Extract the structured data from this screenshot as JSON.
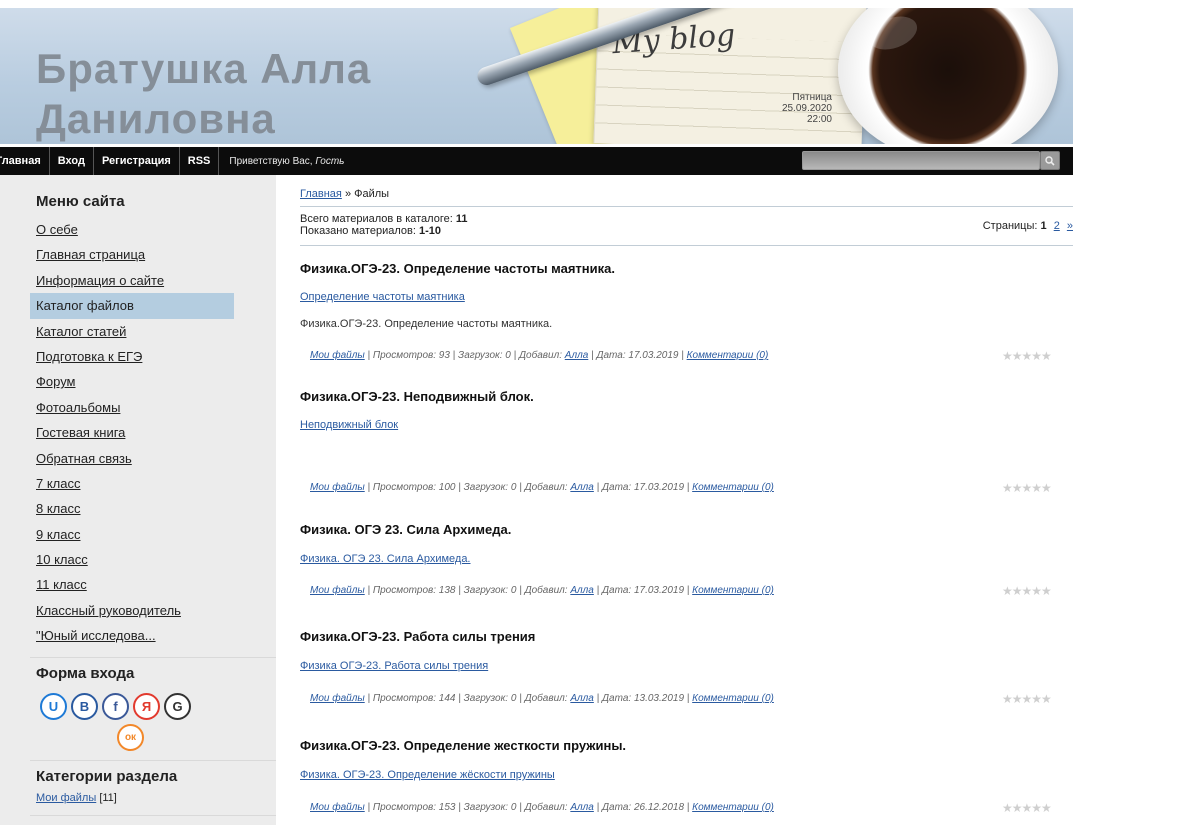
{
  "header": {
    "title_line1": "Братушка Алла",
    "title_line2": "Даниловна",
    "blog_script": "My blog",
    "day": "Пятница",
    "date": "25.09.2020",
    "time": "22:00"
  },
  "nav": {
    "items": [
      "Главная",
      "Вход",
      "Регистрация",
      "RSS"
    ],
    "greeting_prefix": "Приветствую Вас,",
    "greeting_name": "Гость",
    "search_value": ""
  },
  "sidebar": {
    "menu_title": "Меню сайта",
    "menu": [
      "О себе",
      "Главная страница",
      "Информация о сайте",
      "Каталог файлов",
      "Каталог статей",
      "Подготовка к ЕГЭ",
      "Форум",
      "Фотоальбомы",
      "Гостевая книга",
      "Обратная связь",
      "7 класс",
      "8 класс",
      "9 класс",
      "10 класс",
      "11 класс",
      "Классный руководитель",
      "\"Юный исследова..."
    ],
    "active_item": "Каталог файлов",
    "login_title": "Форма входа",
    "social": [
      "U",
      "В",
      "f",
      "Я",
      "G",
      "ок"
    ],
    "categories_title": "Категории раздела",
    "category_link": "Мои файлы",
    "category_count": "[11]"
  },
  "main": {
    "breadcrumb_home": "Главная",
    "breadcrumb_sep": "»",
    "breadcrumb_current": "Файлы",
    "total_label": "Всего материалов в каталоге:",
    "total_value": "11",
    "shown_label": "Показано материалов:",
    "shown_value": "1-10",
    "pages_label": "Страницы:",
    "page_current": "1",
    "page_next": "2",
    "page_arrow": "»",
    "entries": [
      {
        "title": "Физика.ОГЭ-23. Определение частоты маятника.",
        "link": "Определение частоты маятника",
        "desc": "Физика.ОГЭ-23. Определение частоты маятника.",
        "category": "Мои файлы",
        "views": "| Просмотров: 93 | Загрузок: 0 | Добавил:",
        "author": "Алла",
        "date": "| Дата: 17.03.2019 |",
        "comments": "Комментарии (0)"
      },
      {
        "title": "Физика.ОГЭ-23. Неподвижный блок.",
        "link": "Неподвижный блок",
        "desc": "",
        "category": "Мои файлы",
        "views": "| Просмотров: 100 | Загрузок: 0 | Добавил:",
        "author": "Алла",
        "date": "| Дата: 17.03.2019 |",
        "comments": "Комментарии (0)"
      },
      {
        "title": "Физика. ОГЭ 23. Сила Архимеда.",
        "link": "Физика. ОГЭ 23. Сила Архимеда.",
        "desc": "",
        "category": "Мои файлы",
        "views": "| Просмотров: 138 | Загрузок: 0 | Добавил:",
        "author": "Алла",
        "date": "| Дата: 17.03.2019 |",
        "comments": "Комментарии (0)"
      },
      {
        "title": "Физика.ОГЭ-23. Работа силы трения",
        "link": "Физика ОГЭ-23. Работа силы трения",
        "desc": "",
        "category": "Мои файлы",
        "views": "| Просмотров: 144 | Загрузок: 0 | Добавил:",
        "author": "Алла",
        "date": "| Дата: 13.03.2019 |",
        "comments": "Комментарии (0)"
      },
      {
        "title": "Физика.ОГЭ-23. Определение жесткости пружины.",
        "link": "Физика. ОГЭ-23. Определение жёскости пружины",
        "desc": "",
        "category": "Мои файлы",
        "views": "| Просмотров: 153 | Загрузок: 0 | Добавил:",
        "author": "Алла",
        "date": "| Дата: 26.12.2018 |",
        "comments": "Комментарии (0)"
      }
    ],
    "rating_stars": "★★★★★"
  },
  "colors": {
    "social_u": "#1e7ad6",
    "social_v": "#2a5aa0",
    "social_f": "#3b5998",
    "social_ya": "#e23a2e",
    "social_g": "#333333",
    "social_ok": "#f2882a"
  }
}
